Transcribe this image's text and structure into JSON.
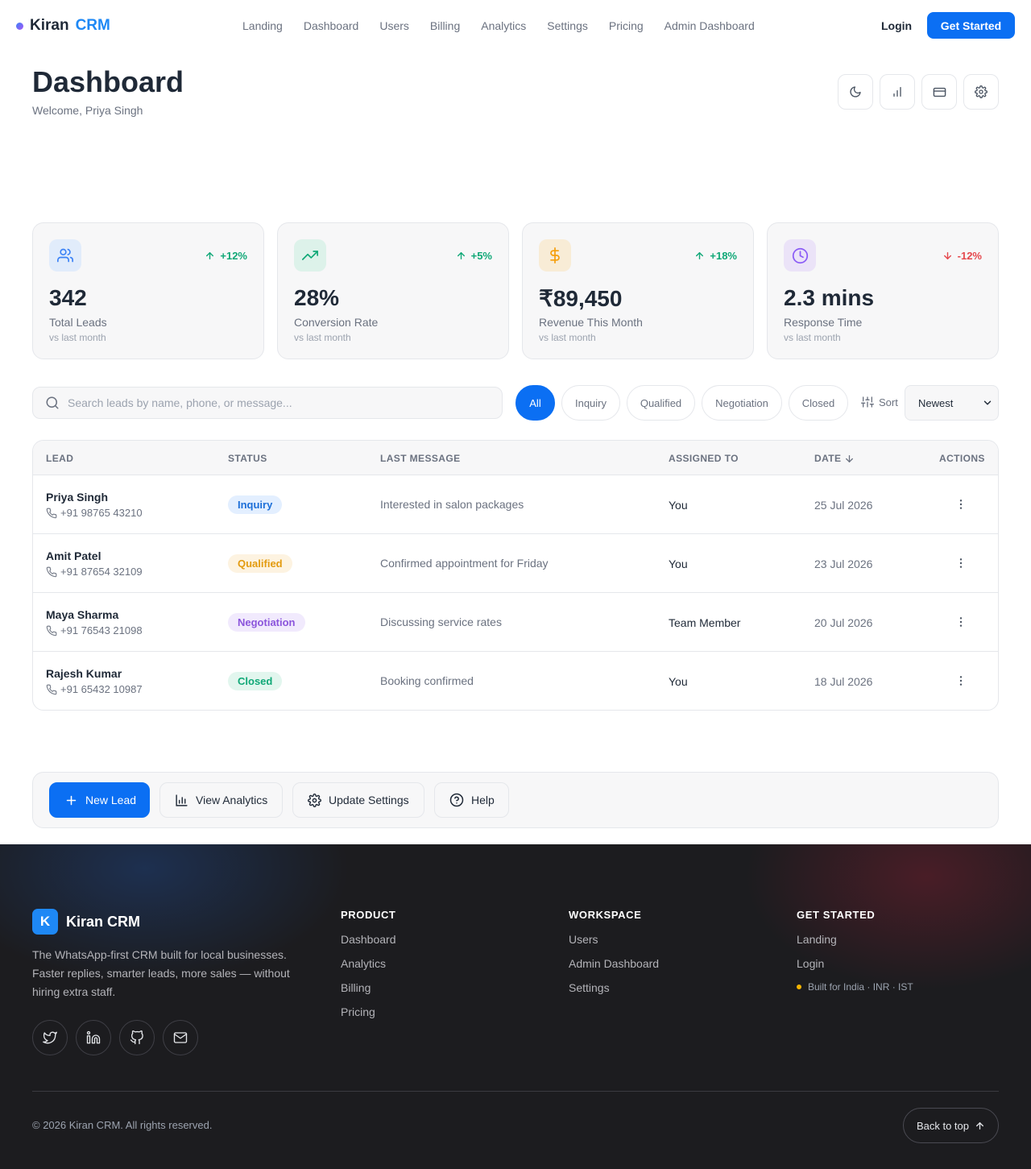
{
  "brand": {
    "part1": "Kiran",
    "part2": "CRM"
  },
  "nav": {
    "links": [
      "Landing",
      "Dashboard",
      "Users",
      "Billing",
      "Analytics",
      "Settings",
      "Pricing",
      "Admin Dashboard"
    ],
    "login": "Login",
    "get_started": "Get Started"
  },
  "header": {
    "title": "Dashboard",
    "welcome": "Welcome, Priya Singh",
    "tools": [
      "moon-icon",
      "bar-chart-icon",
      "credit-card-icon",
      "gear-icon"
    ]
  },
  "stats": [
    {
      "icon": "users-icon",
      "trend": "+12%",
      "direction": "up",
      "value": "342",
      "label": "Total Leads",
      "sub": "vs last month",
      "color": "#3b82f6"
    },
    {
      "icon": "trending-up-icon",
      "trend": "+5%",
      "direction": "up",
      "value": "28%",
      "label": "Conversion Rate",
      "sub": "vs last month",
      "color": "#10b981"
    },
    {
      "icon": "dollar-icon",
      "trend": "+18%",
      "direction": "up",
      "value": "₹89,450",
      "label": "Revenue This Month",
      "sub": "vs last month",
      "color": "#f59e0b"
    },
    {
      "icon": "clock-icon",
      "trend": "-12%",
      "direction": "down",
      "value": "2.3 mins",
      "label": "Response Time",
      "sub": "vs last month",
      "color": "#8b5cf6"
    }
  ],
  "filters": {
    "search_placeholder": "Search leads by name, phone, or message...",
    "pills": [
      "All",
      "Inquiry",
      "Qualified",
      "Negotiation",
      "Closed"
    ],
    "active": "All",
    "sort_label": "Sort",
    "sort_value": "Newest"
  },
  "table": {
    "headers": [
      "LEAD",
      "STATUS",
      "LAST MESSAGE",
      "ASSIGNED TO",
      "DATE",
      "ACTIONS"
    ],
    "rows": [
      {
        "name": "Priya Singh",
        "phone": "+91 98765 43210",
        "status": "Inquiry",
        "message": "Interested in salon packages",
        "assigned": "You",
        "date": "25 Jul 2026"
      },
      {
        "name": "Amit Patel",
        "phone": "+91 87654 32109",
        "status": "Qualified",
        "message": "Confirmed appointment for Friday",
        "assigned": "You",
        "date": "23 Jul 2026"
      },
      {
        "name": "Maya Sharma",
        "phone": "+91 76543 21098",
        "status": "Negotiation",
        "message": "Discussing service rates",
        "assigned": "Team Member",
        "date": "20 Jul 2026"
      },
      {
        "name": "Rajesh Kumar",
        "phone": "+91 65432 10987",
        "status": "Closed",
        "message": "Booking confirmed",
        "assigned": "You",
        "date": "18 Jul 2026"
      }
    ]
  },
  "status_colors": {
    "Inquiry": {
      "bg": "#e3efff",
      "fg": "#1d6fd8"
    },
    "Qualified": {
      "bg": "#fdf3e1",
      "fg": "#e39b10"
    },
    "Negotiation": {
      "bg": "#f1eafd",
      "fg": "#8b55dc"
    },
    "Closed": {
      "bg": "#e2f6ee",
      "fg": "#10a877"
    }
  },
  "quick_actions": {
    "new_lead": "New Lead",
    "view_analytics": "View Analytics",
    "update_settings": "Update Settings",
    "help": "Help"
  },
  "footer": {
    "logo_letter": "K",
    "brand": "Kiran CRM",
    "tagline": "The WhatsApp-first CRM built for local businesses. Faster replies, smarter leads, more sales — without hiring extra staff.",
    "socials": [
      "twitter-icon",
      "linkedin-icon",
      "github-icon",
      "mail-icon"
    ],
    "product": {
      "heading": "PRODUCT",
      "links": [
        "Dashboard",
        "Analytics",
        "Billing",
        "Pricing"
      ]
    },
    "workspace": {
      "heading": "WORKSPACE",
      "links": [
        "Users",
        "Admin Dashboard",
        "Settings"
      ]
    },
    "get_started": {
      "heading": "GET STARTED",
      "links": [
        "Landing",
        "Login"
      ],
      "note": "Built for India · INR · IST"
    },
    "copyright": "© 2026 Kiran CRM. All rights reserved.",
    "back_to_top": "Back to top"
  }
}
